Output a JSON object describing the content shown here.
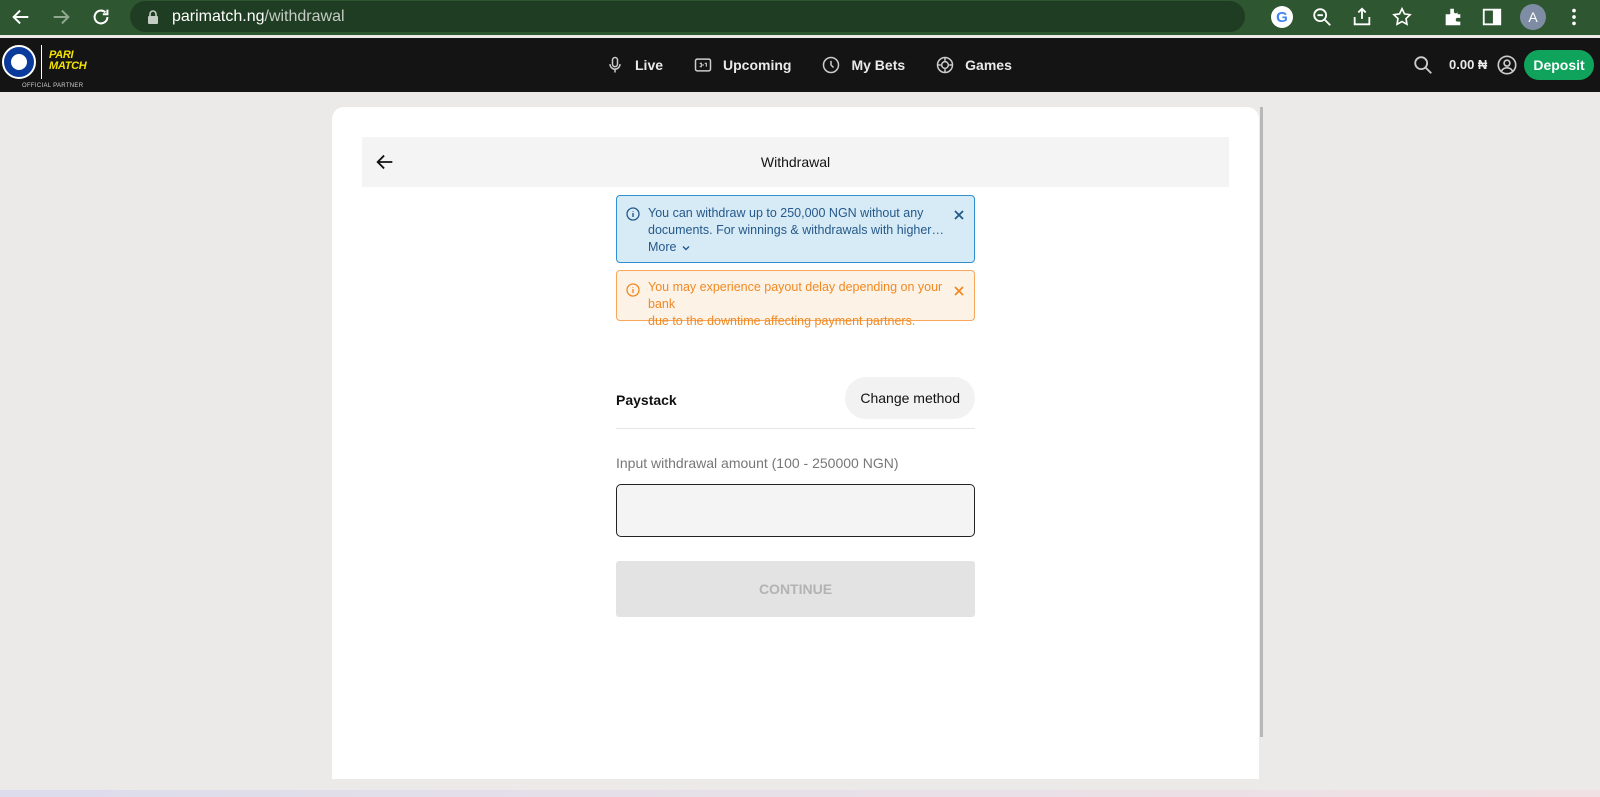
{
  "browser": {
    "url_host": "parimatch.ng",
    "url_path": "/withdrawal",
    "profile_initial": "A"
  },
  "header": {
    "brand_line1": "PARI",
    "brand_line2": "MATCH",
    "partner_label": "OFFICIAL PARTNER",
    "nav": [
      {
        "label": "Live",
        "icon": "microphone-icon"
      },
      {
        "label": "Upcoming",
        "icon": "scoreboard-icon"
      },
      {
        "label": "My Bets",
        "icon": "clock-icon"
      },
      {
        "label": "Games",
        "icon": "chip-icon"
      }
    ],
    "balance": "0.00 ₦",
    "deposit_label": "Deposit"
  },
  "withdrawal": {
    "title": "Withdrawal",
    "info_alert": {
      "line1": "You can withdraw up to 250,000 NGN without any",
      "line2": "documents. For winnings & withdrawals with higher…",
      "more_label": "More"
    },
    "warning_alert": {
      "line1": "You may experience payout delay depending on your bank",
      "line2": "due to the downtime affecting payment partners."
    },
    "method_name": "Paystack",
    "change_method_label": "Change method",
    "amount_label": "Input withdrawal amount (100 - 250000 NGN)",
    "amount_value": "",
    "continue_label": "CONTINUE"
  },
  "colors": {
    "chrome": "#2e5630",
    "header": "#141414",
    "deposit": "#10a35c",
    "info": "#2f8fd0",
    "warning": "#f08a24"
  }
}
